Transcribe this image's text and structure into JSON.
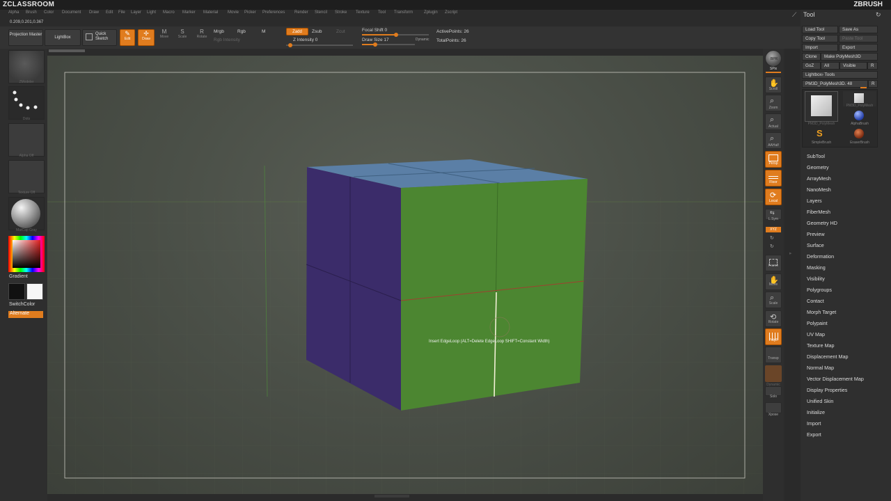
{
  "app": {
    "brand_left": "ZCLASSROOM",
    "brand_right": "ZBRUSH"
  },
  "menu": [
    "Alpha",
    "Brush",
    "Color",
    "Document",
    "Draw",
    "Edit",
    "File",
    "Layer",
    "Light",
    "Macro",
    "Marker",
    "Material",
    "Movie",
    "Picker",
    "Preferences",
    "Render",
    "Stencil",
    "Stroke",
    "Texture",
    "Tool",
    "Transform",
    "Zplugin",
    "Zscript"
  ],
  "coords": "0.209,0.201,0.367",
  "topshelf": {
    "projection_master": "Projection Master",
    "lightbox": "LightBox",
    "quick_sketch": "Quick Sketch",
    "edit": "Edit",
    "draw": "Draw",
    "move": "Move",
    "scale": "Scale",
    "rotate": "Rotate",
    "mrgb": "Mrgb",
    "rgb": "Rgb",
    "m": "M",
    "rgb_intensity": "Rgb Intensity",
    "zadd": "Zadd",
    "zsub": "Zsub",
    "zcut": "Zcut",
    "z_intensity": "Z Intensity 0",
    "focal_shift": "Focal Shift 0",
    "draw_size": "Draw Size 17",
    "dynamic": "Dynamic",
    "active_points": "ActivePoints: 26",
    "total_points": "TotalPoints: 26"
  },
  "leftshelf": {
    "material_label": "ZModeler",
    "dots_label": "Dots",
    "alpha_label": "Alpha Off",
    "texture_label": "Texture Off",
    "matcap_label": "MatCap Gray",
    "gradient": "Gradient",
    "switch_color": "SwitchColor",
    "alternate": "Alternate"
  },
  "rightshelf": {
    "bpr": "BPR",
    "spix": "SPix",
    "scroll": "Scroll",
    "zoom": "Zoom",
    "actual": "Actual",
    "aahalf": "AAHalf",
    "persp": "Persp",
    "floor": "Floor",
    "local": "Local",
    "lsym": "L.Sym",
    "xyz": "XYZ",
    "frame": "Frame",
    "move": "Move",
    "scale": "Scale",
    "rotate": "Rotate",
    "polyf": "PolyF",
    "transp": "Transp",
    "ghost": "Dynamic",
    "solo": "Solo",
    "xpose": "Xpose"
  },
  "tool": {
    "title": "Tool",
    "load_tool": "Load Tool",
    "save_as": "Save As",
    "copy_tool": "Copy Tool",
    "paste_tool": "Paste Tool",
    "import": "Import",
    "export": "Export",
    "clone": "Clone",
    "make_polymesh": "Make PolyMesh3D",
    "goz": "GoZ",
    "all": "All",
    "visible": "Visible",
    "r": "R",
    "lightbox_tools": "Lightbox› Tools",
    "current_tool": "PM3D_PolyMesh3D. 48",
    "thumbs": [
      "PM3D_PolyMesh",
      "PM3D_PolyMesh",
      "AlphaBrush",
      "SimpleBrush",
      "EraserBrush"
    ],
    "menus": [
      "SubTool",
      "Geometry",
      "ArrayMesh",
      "NanoMesh",
      "Layers",
      "FiberMesh",
      "Geometry HD",
      "Preview",
      "Surface",
      "Deformation",
      "Masking",
      "Visibility",
      "Polygroups",
      "Contact",
      "Morph Target",
      "Polypaint",
      "UV Map",
      "Texture Map",
      "Displacement Map",
      "Normal Map",
      "Vector Displacement Map",
      "Display Properties",
      "Unified Skin",
      "Initialize",
      "Import",
      "Export"
    ]
  },
  "viewport": {
    "hint": "Insert EdgeLoop (ALT=Delete EdgeLoop SHIFT=Constant Width)"
  },
  "colors": {
    "accent": "#e07c1e",
    "cube_front": "#4f8a32",
    "cube_side": "#3d2f6e",
    "cube_top": "#5b7fa6"
  }
}
